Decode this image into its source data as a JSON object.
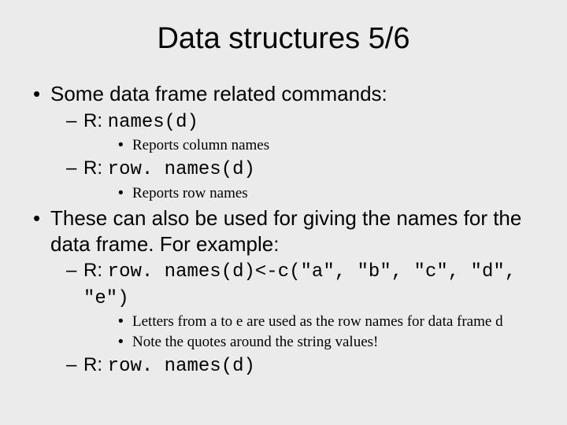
{
  "title": "Data structures 5/6",
  "b1": {
    "text": "Some data frame related commands:",
    "sub": [
      {
        "prefix": "R: ",
        "code": "names(d)",
        "notes": [
          "Reports column names"
        ]
      },
      {
        "prefix": "R: ",
        "code": "row. names(d)",
        "notes": [
          "Reports row names"
        ]
      }
    ]
  },
  "b2": {
    "text": "These can also be used for giving the names for the data frame. For example:",
    "sub": [
      {
        "prefix": "R: ",
        "code": "row. names(d)<-c(\"a\", \"b\", \"c\", \"d\", \"e\")",
        "notes": [
          "Letters from a to e are used as the row names for data frame d",
          "Note the quotes around the string values!"
        ]
      },
      {
        "prefix": "R: ",
        "code": "row. names(d)",
        "notes": []
      }
    ]
  }
}
